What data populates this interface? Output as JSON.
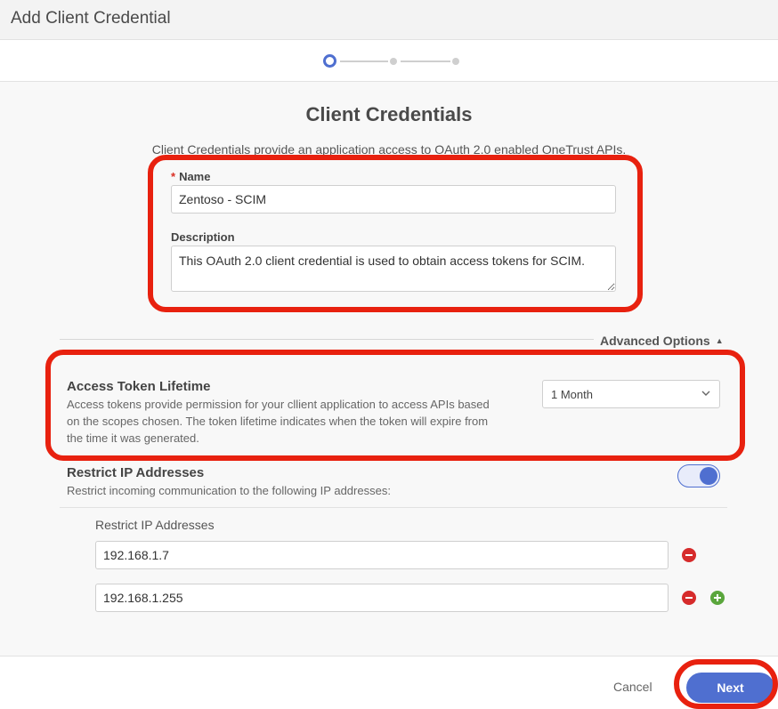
{
  "window": {
    "title": "Add Client Credential"
  },
  "stepper": {
    "current_step": 1,
    "total_steps": 3
  },
  "form": {
    "heading": "Client Credentials",
    "intro": "Client Credentials provide an application access to OAuth 2.0 enabled OneTrust APIs.",
    "name": {
      "required_mark": "*",
      "label": "Name",
      "value": "Zentoso - SCIM"
    },
    "description": {
      "label": "Description",
      "value": "This OAuth 2.0 client credential is used to obtain access tokens for SCIM."
    }
  },
  "advanced_options": {
    "label": "Advanced Options",
    "expanded": true
  },
  "access_token_lifetime": {
    "title": "Access Token Lifetime",
    "description_lines": [
      "Access tokens provide permission for your cllient application to access APIs based",
      "on the scopes chosen. The token lifetime indicates when the token will expire from",
      "the time it was generated."
    ],
    "selected": "1 Month"
  },
  "restrict_ip": {
    "title": "Restrict IP Addresses",
    "description": "Restrict incoming communication to the following IP addresses:",
    "enabled": true,
    "list_label": "Restrict IP Addresses",
    "addresses": [
      "192.168.1.7",
      "192.168.1.255"
    ]
  },
  "footer": {
    "cancel_label": "Cancel",
    "next_label": "Next"
  },
  "colors": {
    "accent": "#4f6fd0",
    "highlight": "#e8210f",
    "remove": "#d62b2b",
    "add": "#5aa63c"
  },
  "icons": {
    "caret": "caret-up-icon",
    "dropdown": "chevron-down-icon",
    "remove": "remove-circle-icon",
    "add": "add-circle-icon"
  }
}
